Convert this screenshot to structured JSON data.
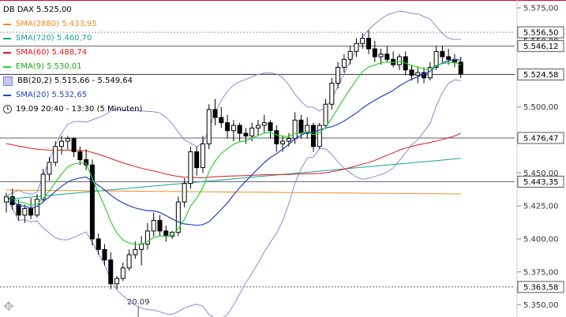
{
  "chart_data": {
    "type": "candlestick",
    "instrument_label": "DB DAX",
    "y_ticks": [
      5350,
      5375,
      5400,
      5425,
      5450,
      5475,
      5500,
      5525,
      5550,
      5575
    ],
    "y_tick_labels": [
      "5.350,00",
      "5.375,00",
      "5.400,00",
      "5.425,00",
      "5.450,00",
      "5.475,00",
      "5.500,00",
      "5.525,00",
      "5.550,00",
      "5.575,00"
    ],
    "ylim": [
      5348,
      5578
    ],
    "x_tick_labels": [
      "20.09"
    ],
    "x_ticks_index": [
      22
    ],
    "timeframe_text": "19.09 20:40 - 13:30 (5 Minuten)",
    "legend": [
      {
        "key": "price",
        "label": "DB DAX 5.525,00",
        "color": "#000000",
        "kind": "none"
      },
      {
        "key": "sma2880",
        "label": "SMA(2880) 5.433,95",
        "color": "#f08a1c",
        "kind": "line"
      },
      {
        "key": "sma720",
        "label": "SMA(720) 5.460,70",
        "color": "#17a39a",
        "kind": "line"
      },
      {
        "key": "sma60",
        "label": "SMA(60) 5.488,74",
        "color": "#e0161c",
        "kind": "line"
      },
      {
        "key": "ema9",
        "label": "EMA(9) 5.530,01",
        "color": "#2ed12e",
        "kind": "line"
      },
      {
        "key": "bb",
        "label": "BB(20,2) 5.515,66 - 5.549,64",
        "color": "#8a8ad8",
        "kind": "box"
      },
      {
        "key": "sma20",
        "label": "SMA(20) 5.532,65",
        "color": "#2342c8",
        "kind": "line"
      }
    ],
    "price_markers": [
      {
        "value": 5556.5,
        "label": "5.556,50",
        "style": "dashed",
        "color": "#9a9a9a"
      },
      {
        "value": 5546.12,
        "label": "5.546,12",
        "style": "solid",
        "color": "#606060"
      },
      {
        "value": 5524.58,
        "label": "5.524,58",
        "style": "solid",
        "color": "#303030"
      },
      {
        "value": 5476.47,
        "label": "5.476,47",
        "style": "solid",
        "color": "#606060"
      },
      {
        "value": 5443.35,
        "label": "5.443,35",
        "style": "solid",
        "color": "#606060"
      },
      {
        "value": 5363.58,
        "label": "5.363,58",
        "style": "dashed",
        "color": "#606060"
      }
    ],
    "candles": [
      [
        5428,
        5435,
        5420,
        5432
      ],
      [
        5432,
        5438,
        5422,
        5426
      ],
      [
        5426,
        5430,
        5414,
        5418
      ],
      [
        5418,
        5426,
        5412,
        5423
      ],
      [
        5423,
        5431,
        5415,
        5418
      ],
      [
        5418,
        5434,
        5416,
        5430
      ],
      [
        5430,
        5453,
        5428,
        5449
      ],
      [
        5449,
        5462,
        5444,
        5458
      ],
      [
        5458,
        5474,
        5455,
        5470
      ],
      [
        5470,
        5478,
        5464,
        5474
      ],
      [
        5474,
        5478,
        5468,
        5476
      ],
      [
        5476,
        5477,
        5462,
        5466
      ],
      [
        5466,
        5470,
        5456,
        5460
      ],
      [
        5460,
        5468,
        5452,
        5456
      ],
      [
        5456,
        5460,
        5395,
        5400
      ],
      [
        5400,
        5404,
        5388,
        5392
      ],
      [
        5392,
        5396,
        5380,
        5384
      ],
      [
        5384,
        5390,
        5362,
        5366
      ],
      [
        5366,
        5372,
        5362,
        5370
      ],
      [
        5370,
        5382,
        5368,
        5378
      ],
      [
        5378,
        5392,
        5376,
        5388
      ],
      [
        5388,
        5398,
        5385,
        5392
      ],
      [
        5392,
        5402,
        5380,
        5396
      ],
      [
        5396,
        5412,
        5392,
        5406
      ],
      [
        5406,
        5420,
        5402,
        5414
      ],
      [
        5414,
        5418,
        5402,
        5406
      ],
      [
        5406,
        5410,
        5398,
        5402
      ],
      [
        5402,
        5406,
        5400,
        5405
      ],
      [
        5405,
        5432,
        5402,
        5428
      ],
      [
        5428,
        5446,
        5424,
        5442
      ],
      [
        5442,
        5470,
        5438,
        5466
      ],
      [
        5466,
        5470,
        5448,
        5454
      ],
      [
        5454,
        5478,
        5450,
        5472
      ],
      [
        5472,
        5502,
        5468,
        5498
      ],
      [
        5498,
        5506,
        5486,
        5492
      ],
      [
        5492,
        5500,
        5484,
        5488
      ],
      [
        5488,
        5494,
        5476,
        5482
      ],
      [
        5482,
        5490,
        5474,
        5486
      ],
      [
        5486,
        5488,
        5474,
        5480
      ],
      [
        5480,
        5484,
        5472,
        5478
      ],
      [
        5478,
        5488,
        5474,
        5484
      ],
      [
        5484,
        5490,
        5478,
        5486
      ],
      [
        5486,
        5494,
        5480,
        5488
      ],
      [
        5488,
        5490,
        5476,
        5482
      ],
      [
        5482,
        5486,
        5466,
        5472
      ],
      [
        5472,
        5478,
        5466,
        5474
      ],
      [
        5474,
        5480,
        5470,
        5476
      ],
      [
        5476,
        5496,
        5472,
        5490
      ],
      [
        5490,
        5494,
        5476,
        5480
      ],
      [
        5480,
        5492,
        5476,
        5486
      ],
      [
        5486,
        5488,
        5466,
        5470
      ],
      [
        5470,
        5488,
        5468,
        5486
      ],
      [
        5486,
        5506,
        5484,
        5502
      ],
      [
        5502,
        5522,
        5498,
        5518
      ],
      [
        5518,
        5534,
        5514,
        5530
      ],
      [
        5530,
        5540,
        5526,
        5536
      ],
      [
        5536,
        5546,
        5532,
        5542
      ],
      [
        5542,
        5552,
        5538,
        5548
      ],
      [
        5548,
        5556,
        5544,
        5552
      ],
      [
        5552,
        5558,
        5540,
        5544
      ],
      [
        5544,
        5550,
        5534,
        5538
      ],
      [
        5538,
        5544,
        5532,
        5540
      ],
      [
        5540,
        5546,
        5534,
        5536
      ],
      [
        5536,
        5542,
        5530,
        5532
      ],
      [
        5532,
        5540,
        5528,
        5538
      ],
      [
        5538,
        5542,
        5524,
        5528
      ],
      [
        5528,
        5532,
        5520,
        5524
      ],
      [
        5524,
        5530,
        5518,
        5526
      ],
      [
        5526,
        5530,
        5518,
        5522
      ],
      [
        5522,
        5534,
        5520,
        5530
      ],
      [
        5530,
        5546,
        5528,
        5542
      ],
      [
        5542,
        5546,
        5534,
        5538
      ],
      [
        5538,
        5544,
        5532,
        5536
      ],
      [
        5536,
        5540,
        5530,
        5534
      ],
      [
        5534,
        5538,
        5522,
        5525
      ]
    ]
  }
}
